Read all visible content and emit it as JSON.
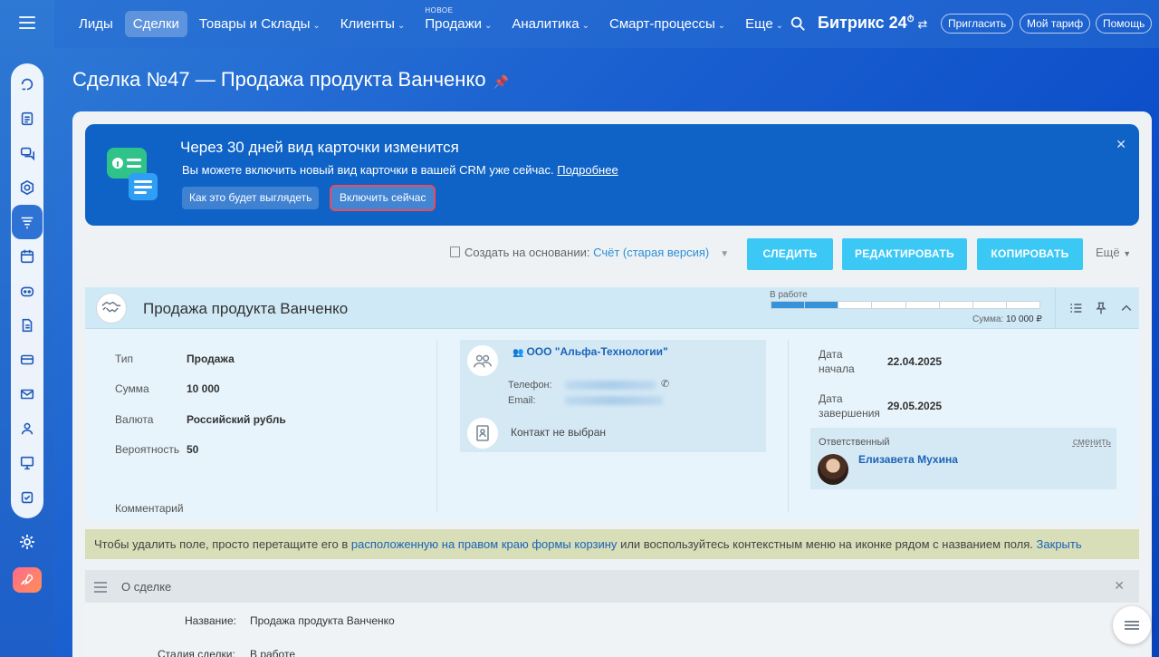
{
  "nav": {
    "items": [
      {
        "label": "Лиды",
        "chev": false,
        "active": false
      },
      {
        "label": "Сделки",
        "chev": false,
        "active": true
      },
      {
        "label": "Товары и Склады",
        "chev": true,
        "active": false
      },
      {
        "label": "Клиенты",
        "chev": true,
        "active": false
      },
      {
        "label": "Продажи",
        "chev": true,
        "active": false,
        "badge": "НОВОЕ"
      },
      {
        "label": "Аналитика",
        "chev": true,
        "active": false
      },
      {
        "label": "Смарт-процессы",
        "chev": true,
        "active": false
      },
      {
        "label": "Еще",
        "chev": true,
        "active": false
      }
    ],
    "brand": "Битрикс 24",
    "invite": "Пригласить",
    "tariff": "Мой тариф",
    "help": "Помощь"
  },
  "page": {
    "title": "Сделка №47 — Продажа продукта Ванченко"
  },
  "banner": {
    "title": "Через 30 дней вид карточки изменится",
    "text": "Вы можете включить новый вид карточки в вашей CRM уже сейчас.",
    "link": "Подробнее",
    "preview_button": "Как это будет выглядеть",
    "enable_button": "Включить сейчас"
  },
  "toolbar": {
    "create_based": "Создать на основании:",
    "create_based_value": "Счёт (старая версия)",
    "follow": "СЛЕДИТЬ",
    "edit": "РЕДАКТИРОВАТЬ",
    "copy": "КОПИРОВАТЬ",
    "more": "Ещё"
  },
  "deal": {
    "name": "Продажа продукта Ванченко",
    "stage": "В работе",
    "stage_segments_filled": 2,
    "stage_segments_total": 8,
    "sum_label": "Сумма:",
    "sum_value": "10 000 ₽",
    "fields": {
      "type_label": "Тип",
      "type_value": "Продажа",
      "sum_field_label": "Сумма",
      "sum_field_value": "10 000",
      "currency_label": "Валюта",
      "currency_value": "Российский рубль",
      "probability_label": "Вероятность",
      "probability_value": "50",
      "comment_label": "Комментарий"
    },
    "client": {
      "company": "ООО \"Альфа-Технологии\"",
      "phone_label": "Телефон:",
      "email_label": "Email:",
      "contact_none": "Контакт не выбран"
    },
    "dates": {
      "start_label_1": "Дата",
      "start_label_2": "начала",
      "start_value": "22.04.2025",
      "end_label_1": "Дата",
      "end_label_2": "завершения",
      "end_value": "29.05.2025"
    },
    "responsible": {
      "label": "Ответственный",
      "change": "сменить",
      "name": "Елизавета Мухина"
    }
  },
  "hint": {
    "text_1": "Чтобы удалить поле, просто перетащите его в",
    "link_1": "расположенную на правом краю формы корзину",
    "text_2": "или воспользуйтесь контекстным меню на иконке рядом с названием поля.",
    "close": "Закрыть"
  },
  "about": {
    "title": "О сделке",
    "name_label": "Название:",
    "name_value": "Продажа продукта Ванченко",
    "stage_label": "Стадия сделки:",
    "stage_value": "В работе"
  },
  "colors": {
    "accent": "#3bc8f5",
    "banner": "#0f63c7",
    "link": "#1a63b8",
    "highlight_border": "#e94b5a"
  }
}
